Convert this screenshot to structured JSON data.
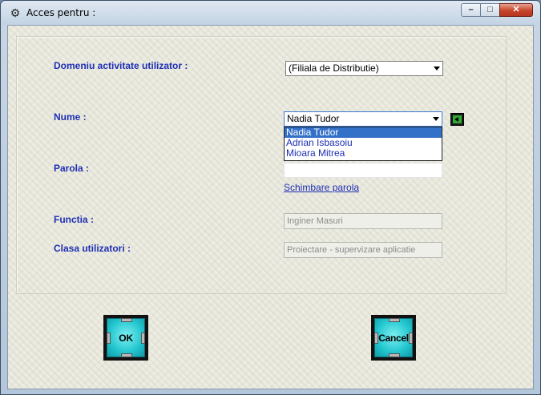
{
  "window": {
    "title": "Acces pentru :",
    "icon": "gears-icon",
    "minimize_glyph": "–",
    "maximize_glyph": "□",
    "close_glyph": "✕"
  },
  "form": {
    "domeniu_label": "Domeniu activitate utilizator :",
    "domeniu_value": "(Filiala de Distributie)",
    "nume_label": "Nume :",
    "nume_value": "Nadia Tudor",
    "nume_options": [
      "Nadia Tudor",
      "Adrian Isbasoiu",
      "Mioara Mitrea"
    ],
    "parola_label": "Parola :",
    "parola_value": "",
    "schimbare_link": "Schimbare parola",
    "functia_label": "Functia :",
    "functia_value": "Inginer Masuri",
    "clasa_label": "Clasa utilizatori :",
    "clasa_value": "Proiectare - supervizare aplicatie"
  },
  "buttons": {
    "ok": "OK",
    "cancel": "Cancel"
  },
  "colors": {
    "label_blue": "#1f2fb5",
    "selected_blue": "#3370c8",
    "button_cyan": "#22c6cf",
    "green_arrow": "#33a833"
  }
}
